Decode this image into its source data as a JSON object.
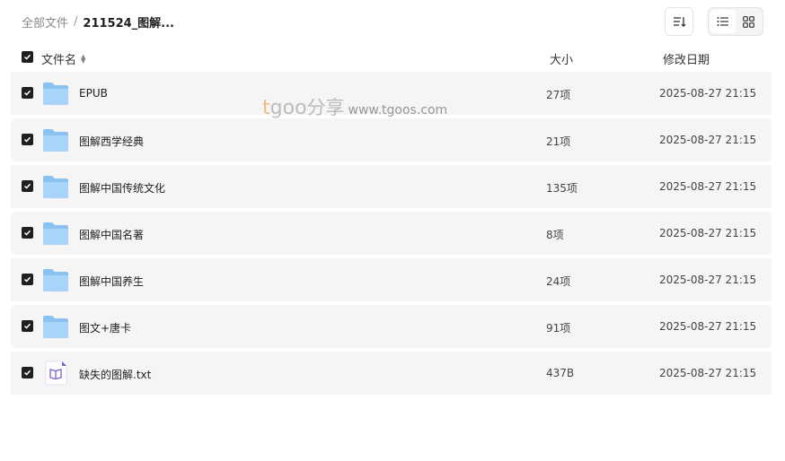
{
  "breadcrumb": {
    "root": "全部文件",
    "separator": "/",
    "current": "211524_图解..."
  },
  "toolbar": {
    "sort_icon": "sort-icon",
    "list_view_icon": "list-view-icon",
    "grid_view_icon": "grid-view-icon",
    "active_view": "list"
  },
  "table": {
    "headers": {
      "name": "文件名",
      "size": "大小",
      "date": "修改日期"
    },
    "rows": [
      {
        "name": "EPUB",
        "size": "27项",
        "date": "2025-08-27 21:15",
        "type": "folder",
        "checked": true
      },
      {
        "name": "图解西学经典",
        "size": "21项",
        "date": "2025-08-27 21:15",
        "type": "folder",
        "checked": true
      },
      {
        "name": "图解中国传统文化",
        "size": "135项",
        "date": "2025-08-27 21:15",
        "type": "folder",
        "checked": true
      },
      {
        "name": "图解中国名著",
        "size": "8项",
        "date": "2025-08-27 21:15",
        "type": "folder",
        "checked": true
      },
      {
        "name": "图解中国养生",
        "size": "24项",
        "date": "2025-08-27 21:15",
        "type": "folder",
        "checked": true
      },
      {
        "name": "图文+唐卡",
        "size": "91项",
        "date": "2025-08-27 21:15",
        "type": "folder",
        "checked": true
      },
      {
        "name": "缺失的图解.txt",
        "size": "437B",
        "date": "2025-08-27 21:15",
        "type": "txt",
        "checked": true
      }
    ]
  },
  "watermark": {
    "brand_t": "t",
    "brand_goo": "goo",
    "brand_cn": "分享",
    "url": "www.tgoos.com"
  },
  "colors": {
    "folder": "#7fb8ee",
    "row_bg": "#f5f5f5",
    "checkbox": "#1f1f1f",
    "txt_icon": "#7b5cd6"
  }
}
